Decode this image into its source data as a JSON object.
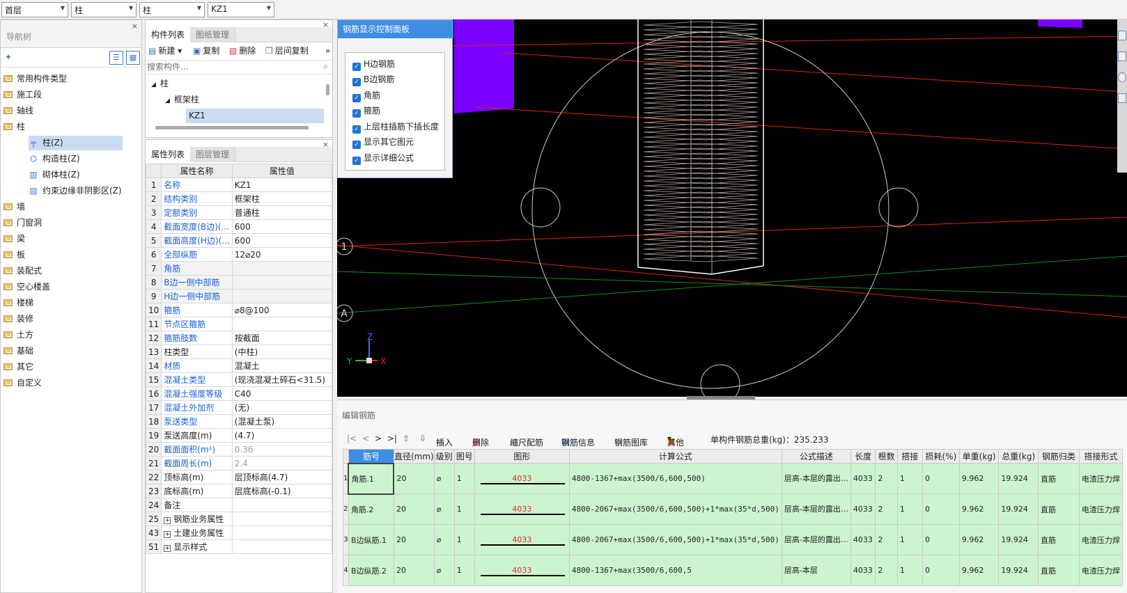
{
  "top_selectors": [
    {
      "value": "首层"
    },
    {
      "value": "柱"
    },
    {
      "value": "柱"
    },
    {
      "value": "KZ1"
    }
  ],
  "nav": {
    "title": "导航树",
    "items": [
      {
        "label": "常用构件类型",
        "level": 0
      },
      {
        "label": "施工段",
        "level": 0
      },
      {
        "label": "轴线",
        "level": 0
      },
      {
        "label": "柱",
        "level": 0
      },
      {
        "label": "柱(Z)",
        "level": 1,
        "selected": true
      },
      {
        "label": "构造柱(Z)",
        "level": 1
      },
      {
        "label": "砌体柱(Z)",
        "level": 1
      },
      {
        "label": "约束边缘非阴影区(Z)",
        "level": 1
      },
      {
        "label": "墙",
        "level": 0
      },
      {
        "label": "门窗洞",
        "level": 0
      },
      {
        "label": "梁",
        "level": 0
      },
      {
        "label": "板",
        "level": 0
      },
      {
        "label": "装配式",
        "level": 0
      },
      {
        "label": "空心楼盖",
        "level": 0
      },
      {
        "label": "楼梯",
        "level": 0
      },
      {
        "label": "装修",
        "level": 0
      },
      {
        "label": "土方",
        "level": 0
      },
      {
        "label": "基础",
        "level": 0
      },
      {
        "label": "其它",
        "level": 0
      },
      {
        "label": "自定义",
        "level": 0
      }
    ]
  },
  "component": {
    "tabs": [
      "构件列表",
      "图纸管理"
    ],
    "toolbar": {
      "new": "新建",
      "copy": "复制",
      "delete": "删除",
      "floor_copy": "层间复制"
    },
    "search_placeholder": "搜索构件...",
    "tree": {
      "root": "柱",
      "group": "框架柱",
      "item": "KZ1"
    }
  },
  "properties": {
    "tabs": [
      "属性列表",
      "图层管理"
    ],
    "headers": [
      "属性名称",
      "属性值"
    ],
    "rows": [
      {
        "n": "1",
        "name": "名称",
        "value": "KZ1",
        "blue": true
      },
      {
        "n": "2",
        "name": "结构类别",
        "value": "框架柱",
        "blue": true
      },
      {
        "n": "3",
        "name": "定额类别",
        "value": "普通柱",
        "blue": true
      },
      {
        "n": "4",
        "name": "截面宽度(B边)(...",
        "value": "600",
        "blue": true
      },
      {
        "n": "5",
        "name": "截面高度(H边)(...",
        "value": "600",
        "blue": true
      },
      {
        "n": "6",
        "name": "全部纵筋",
        "value": "12⌀20",
        "blue": true
      },
      {
        "n": "7",
        "name": "角筋",
        "value": "",
        "blue": true,
        "gray": true
      },
      {
        "n": "8",
        "name": "B边一侧中部筋",
        "value": "",
        "blue": true,
        "gray": true
      },
      {
        "n": "9",
        "name": "H边一侧中部筋",
        "value": "",
        "blue": true,
        "gray": true
      },
      {
        "n": "10",
        "name": "箍筋",
        "value": "⌀8@100",
        "blue": true
      },
      {
        "n": "11",
        "name": "节点区箍筋",
        "value": "",
        "blue": true
      },
      {
        "n": "12",
        "name": "箍筋肢数",
        "value": "按截面",
        "blue": true
      },
      {
        "n": "13",
        "name": "柱类型",
        "value": "(中柱)",
        "blue": false
      },
      {
        "n": "14",
        "name": "材质",
        "value": "混凝土",
        "blue": true
      },
      {
        "n": "15",
        "name": "混凝土类型",
        "value": "(现浇混凝土碎石<31.5)",
        "blue": true
      },
      {
        "n": "16",
        "name": "混凝土强度等级",
        "value": "C40",
        "blue": true
      },
      {
        "n": "17",
        "name": "混凝土外加剂",
        "value": "(无)",
        "blue": true
      },
      {
        "n": "18",
        "name": "泵送类型",
        "value": "(混凝土泵)",
        "blue": true
      },
      {
        "n": "19",
        "name": "泵送高度(m)",
        "value": "(4.7)",
        "blue": false
      },
      {
        "n": "20",
        "name": "截面面积(m²)",
        "value": "0.36",
        "blue": true,
        "grayval": true
      },
      {
        "n": "21",
        "name": "截面周长(m)",
        "value": "2.4",
        "blue": true,
        "grayval": true
      },
      {
        "n": "22",
        "name": "顶标高(m)",
        "value": "层顶标高(4.7)",
        "blue": false
      },
      {
        "n": "23",
        "name": "底标高(m)",
        "value": "层底标高(-0.1)",
        "blue": false
      },
      {
        "n": "24",
        "name": "备注",
        "value": "",
        "blue": false
      },
      {
        "n": "25",
        "name": "钢筋业务属性",
        "value": "",
        "blue": false,
        "group": true
      },
      {
        "n": "43",
        "name": "土建业务属性",
        "value": "",
        "blue": false,
        "group": true
      },
      {
        "n": "51",
        "name": "显示样式",
        "value": "",
        "blue": false,
        "group": true
      }
    ]
  },
  "control_panel": {
    "title": "钢筋显示控制面板",
    "options": [
      "H边钢筋",
      "B边钢筋",
      "角筋",
      "箍筋",
      "上层柱插筋下插长度",
      "显示其它图元",
      "显示详细公式"
    ]
  },
  "viewport": {
    "axis_labels": [
      "1",
      "A"
    ],
    "axes": {
      "x": "X",
      "y": "Y",
      "z": "Z"
    }
  },
  "editor": {
    "title": "编辑钢筋",
    "toolbar": {
      "insert": "插入",
      "delete": "删除",
      "scale": "缩尺配筋",
      "info": "钢筋信息",
      "library": "钢筋图库",
      "other": "其他",
      "total": "单构件钢筋总重(kg)：235.233"
    },
    "headers": [
      "筋号",
      "直径(mm)",
      "级别",
      "图号",
      "图形",
      "计算公式",
      "公式描述",
      "长度",
      "根数",
      "搭接",
      "损耗(%)",
      "单重(kg)",
      "总重(kg)",
      "钢筋归类",
      "搭接形式"
    ],
    "rows": [
      {
        "idx": "1",
        "name": "角筋.1",
        "dia": "20",
        "grade": "⌀",
        "fig": "1",
        "shape": "4033",
        "formula": "4800-1367+max(3500/6,600,500)",
        "desc": "层高-本层的露出…",
        "len": "4033",
        "count": "2",
        "lap": "1",
        "loss": "0",
        "unit": "9.962",
        "total": "19.924",
        "cat": "直筋",
        "lapform": "电渣压力焊"
      },
      {
        "idx": "2",
        "name": "角筋.2",
        "dia": "20",
        "grade": "⌀",
        "fig": "1",
        "shape": "4033",
        "formula": "4800-2067+max(3500/6,600,500)+1*max(35*d,500)",
        "desc": "层高-本层的露出…",
        "len": "4033",
        "count": "2",
        "lap": "1",
        "loss": "0",
        "unit": "9.962",
        "total": "19.924",
        "cat": "直筋",
        "lapform": "电渣压力焊"
      },
      {
        "idx": "3",
        "name": "B边纵筋.1",
        "dia": "20",
        "grade": "⌀",
        "fig": "1",
        "shape": "4033",
        "formula": "4800-2067+max(3500/6,600,500)+1*max(35*d,500)",
        "desc": "层高-本层的露出…",
        "len": "4033",
        "count": "2",
        "lap": "1",
        "loss": "0",
        "unit": "9.962",
        "total": "19.924",
        "cat": "直筋",
        "lapform": "电渣压力焊"
      },
      {
        "idx": "4",
        "name": "B边纵筋.2",
        "dia": "20",
        "grade": "⌀",
        "fig": "1",
        "shape": "4033",
        "formula": "4800-1367+max(3500/6,600,5",
        "desc": "层高-本层",
        "len": "4033",
        "count": "2",
        "lap": "1",
        "loss": "0",
        "unit": "9.962",
        "total": "19.924",
        "cat": "直筋",
        "lapform": "电渣压力焊"
      }
    ]
  },
  "colors": {
    "accent": "#3c8ee5",
    "viewport_bg": "#000000",
    "row_bg": "#ccf5cf",
    "purple": "#7a00ff"
  }
}
